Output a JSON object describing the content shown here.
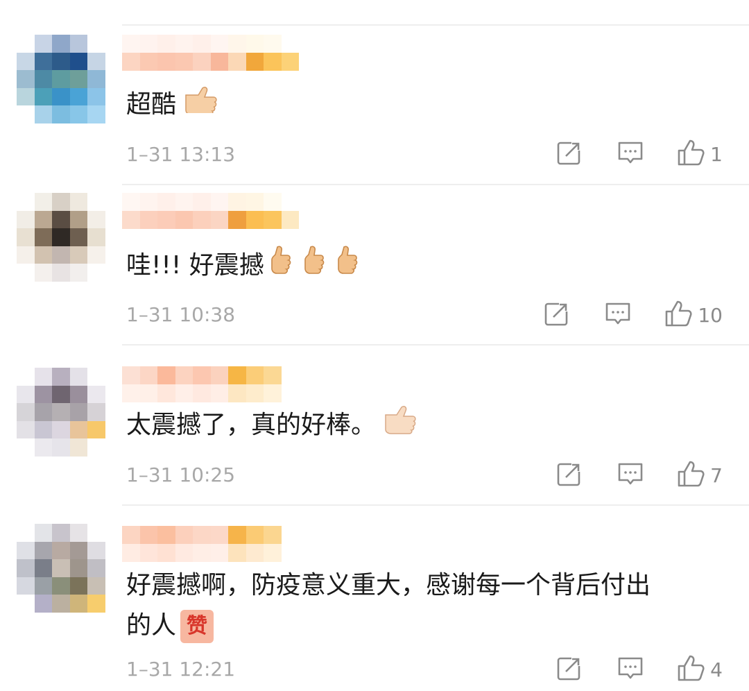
{
  "comments": [
    {
      "text": "超酷",
      "emojis": [
        "thumbs-up-icon"
      ],
      "time": "1–31 13:13",
      "likes": "1"
    },
    {
      "text": "哇!!! 好震撼",
      "emojis": [
        "thumbs-up-icon",
        "thumbs-up-icon",
        "thumbs-up-icon"
      ],
      "time": "1–31 10:38",
      "likes": "10"
    },
    {
      "text": "太震撼了，真的好棒。",
      "emojis": [
        "thumbs-up-icon"
      ],
      "time": "1–31 10:25",
      "likes": "7"
    },
    {
      "text_line1": "好震撼啊，防疫意义重大，感谢每一个背后付出",
      "text_line2": "的人",
      "sticker": "赞",
      "time": "1–31 12:21",
      "likes": "4"
    }
  ],
  "colors": {
    "text": "#1a1a1a",
    "meta": "#a8a8a8",
    "icon": "#8a8a8a",
    "divider": "#eeeeee"
  },
  "icons": [
    "share-icon",
    "reply-icon",
    "like-icon"
  ]
}
